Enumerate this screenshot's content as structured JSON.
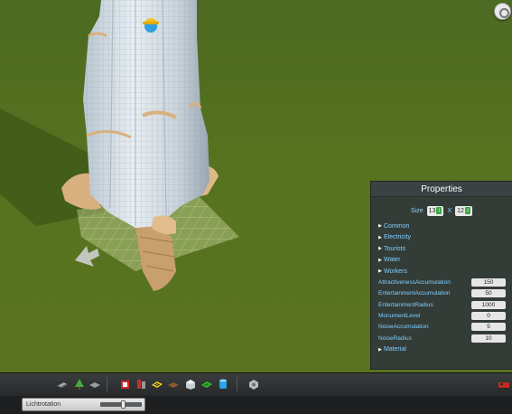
{
  "properties": {
    "title": "Properties",
    "size_label": "Size",
    "size_x": "13",
    "size_sep": "X",
    "size_y": "12",
    "sections_top": [
      {
        "label": "Common"
      },
      {
        "label": "Electricity"
      },
      {
        "label": "Tourists"
      },
      {
        "label": "Water"
      },
      {
        "label": "Workers"
      }
    ],
    "fields": [
      {
        "label": "AttractivenessAccumulation",
        "value": "150"
      },
      {
        "label": "EntertainmentAccumulation",
        "value": "50"
      },
      {
        "label": "EntertainmentRadius",
        "value": "1000"
      },
      {
        "label": "MonumentLevel",
        "value": "0"
      },
      {
        "label": "NoiseAccumulation",
        "value": "5"
      },
      {
        "label": "NoiseRadius",
        "value": "10"
      }
    ],
    "section_bottom": {
      "label": "Material"
    }
  },
  "status": {
    "rotation_label": "Lichtrotation",
    "rotation_level": 0.55
  },
  "toolbar": {
    "icons": [
      "road-icon",
      "tree-icon",
      "surface-icon",
      "bulldoze-icon",
      "zone-icon",
      "warning-stripe-icon",
      "brick-icon",
      "cube-icon",
      "green-tile-icon",
      "water-tank-icon",
      "settings-cube-icon",
      "train-icon"
    ]
  },
  "colors": {
    "panel_bg": "#32383a",
    "label_blue": "#7fd0ff",
    "grass": "#56731f"
  }
}
